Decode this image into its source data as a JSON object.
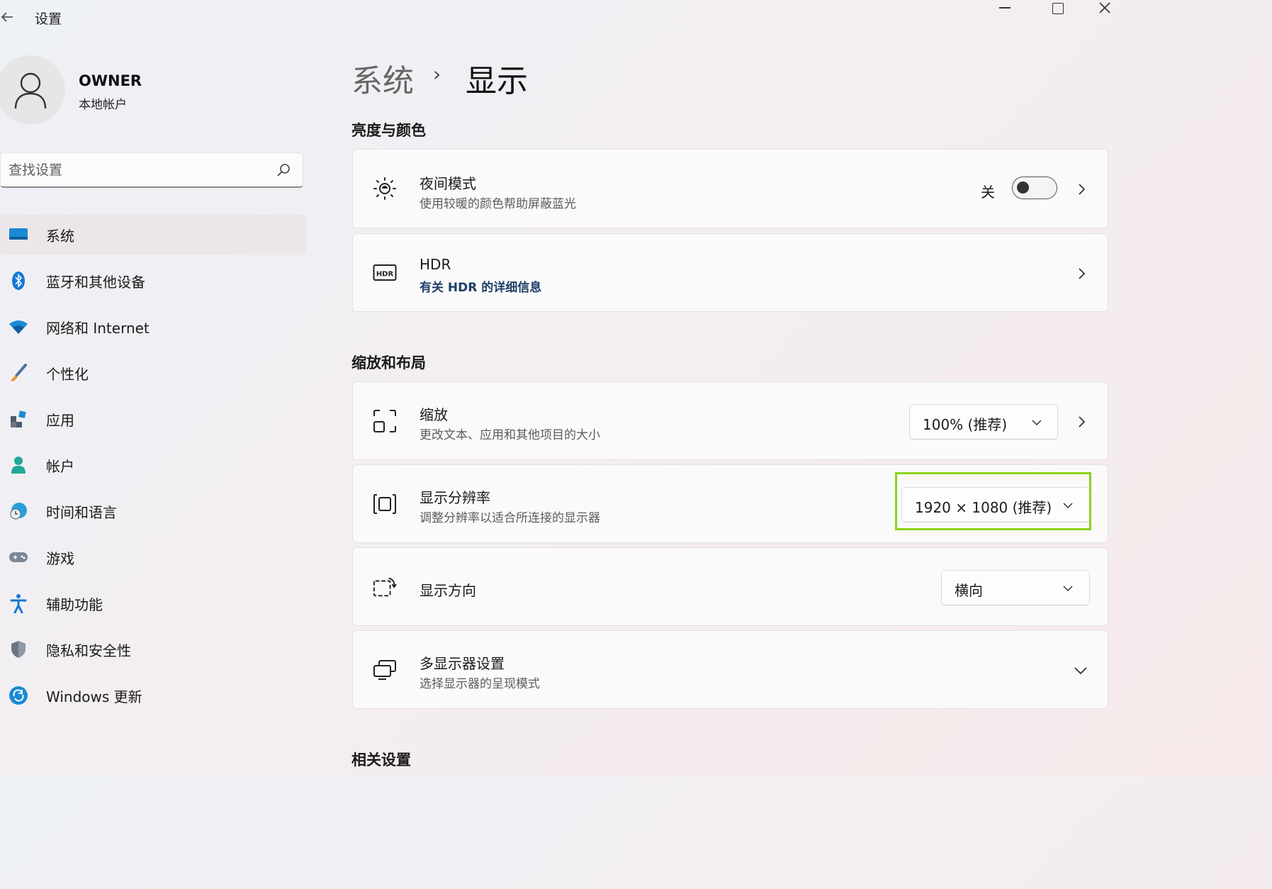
{
  "window": {
    "app_title": "设置"
  },
  "profile": {
    "name": "OWNER",
    "account_type": "本地帐户"
  },
  "search": {
    "placeholder": "查找设置"
  },
  "sidebar": {
    "items": [
      {
        "label": "系统",
        "icon": "system-display-icon",
        "active": true
      },
      {
        "label": "蓝牙和其他设备",
        "icon": "bluetooth-icon"
      },
      {
        "label": "网络和 Internet",
        "icon": "wifi-icon"
      },
      {
        "label": "个性化",
        "icon": "paintbrush-icon"
      },
      {
        "label": "应用",
        "icon": "apps-icon"
      },
      {
        "label": "帐户",
        "icon": "person-icon"
      },
      {
        "label": "时间和语言",
        "icon": "globe-clock-icon"
      },
      {
        "label": "游戏",
        "icon": "gamepad-icon"
      },
      {
        "label": "辅助功能",
        "icon": "accessibility-icon"
      },
      {
        "label": "隐私和安全性",
        "icon": "shield-icon"
      },
      {
        "label": "Windows 更新",
        "icon": "refresh-icon"
      }
    ]
  },
  "breadcrumb": {
    "root": "系统",
    "separator": "›",
    "current": "显示"
  },
  "sections": {
    "brightness_color": "亮度与颜色",
    "scale_layout": "缩放和布局",
    "related": "相关设置"
  },
  "night_light": {
    "title": "夜间模式",
    "subtitle": "使用较暖的颜色帮助屏蔽蓝光",
    "state": "关",
    "enabled": false
  },
  "hdr": {
    "title": "HDR",
    "subtitle": "有关 HDR 的详细信息",
    "icon_text": "HDR"
  },
  "scale": {
    "title": "缩放",
    "subtitle": "更改文本、应用和其他项目的大小",
    "value": "100% (推荐)"
  },
  "resolution": {
    "title": "显示分辨率",
    "subtitle": "调整分辨率以适合所连接的显示器",
    "value": "1920 × 1080 (推荐)"
  },
  "orientation": {
    "title": "显示方向",
    "value": "横向"
  },
  "multi_display": {
    "title": "多显示器设置",
    "subtitle": "选择显示器的呈现模式"
  },
  "colors": {
    "highlight": "#8cd21c",
    "accent_blue": "#0f6cbd"
  }
}
